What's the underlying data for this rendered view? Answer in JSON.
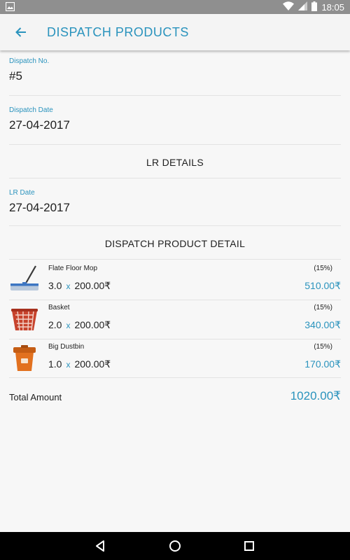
{
  "status_bar": {
    "time": "18:05"
  },
  "app_bar": {
    "title": "DISPATCH PRODUCTS"
  },
  "dispatch_no": {
    "label": "Dispatch No.",
    "value": "#5"
  },
  "dispatch_date": {
    "label": "Dispatch Date",
    "value": "27-04-2017"
  },
  "lr_details": {
    "heading": "LR DETAILS"
  },
  "lr_date": {
    "label": "LR Date",
    "value": "27-04-2017"
  },
  "product_detail": {
    "heading": "DISPATCH PRODUCT DETAIL",
    "items": [
      {
        "name": "Flate Floor Mop",
        "qty": "3.0",
        "times": "x",
        "price": "200.00₹",
        "tax": "(15%)",
        "amount": "510.00₹",
        "icon": "mop-icon"
      },
      {
        "name": "Basket",
        "qty": "2.0",
        "times": "x",
        "price": "200.00₹",
        "tax": "(15%)",
        "amount": "340.00₹",
        "icon": "basket-icon"
      },
      {
        "name": "Big Dustbin",
        "qty": "1.0",
        "times": "x",
        "price": "200.00₹",
        "tax": "(15%)",
        "amount": "170.00₹",
        "icon": "dustbin-icon"
      }
    ]
  },
  "total": {
    "label": "Total Amount",
    "value": "1020.00₹"
  },
  "colors": {
    "accent": "#2a93bd",
    "status_bar": "#8f8f8f",
    "nav_bar": "#000000"
  }
}
